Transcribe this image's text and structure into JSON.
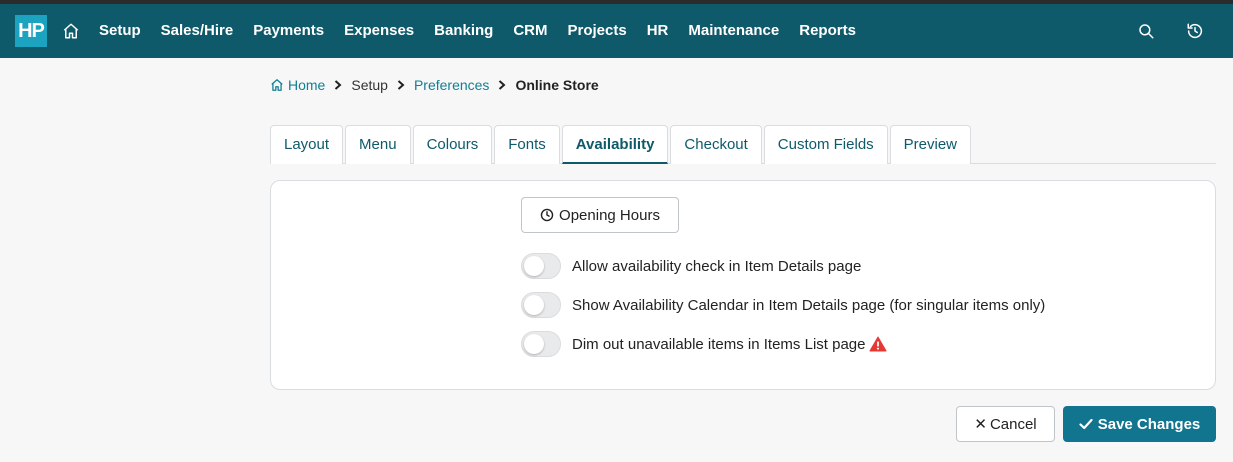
{
  "app": {
    "logo_text": "HP"
  },
  "nav": {
    "items": [
      "Setup",
      "Sales/Hire",
      "Payments",
      "Expenses",
      "Banking",
      "CRM",
      "Projects",
      "HR",
      "Maintenance",
      "Reports"
    ],
    "icons": [
      "home-icon",
      "search-icon",
      "history-icon"
    ]
  },
  "breadcrumb": {
    "home": "Home",
    "setup": "Setup",
    "preferences": "Preferences",
    "current": "Online Store"
  },
  "tabs": {
    "items": [
      "Layout",
      "Menu",
      "Colours",
      "Fonts",
      "Availability",
      "Checkout",
      "Custom Fields",
      "Preview"
    ],
    "active": "Availability"
  },
  "panel": {
    "opening_hours_label": "Opening Hours",
    "toggles": [
      {
        "label": "Allow availability check in Item Details page",
        "on": false
      },
      {
        "label": "Show Availability Calendar in Item Details page (for singular items only)",
        "on": false
      },
      {
        "label": "Dim out unavailable items in Items List page",
        "on": false,
        "warning": true
      }
    ]
  },
  "footer": {
    "cancel_label": "Cancel",
    "save_label": "Save Changes"
  },
  "colors": {
    "navbar": "#0e5a6b",
    "logo": "#1ba3bf",
    "link": "#127f94",
    "primary_button": "#127590",
    "warning": "#e53935"
  }
}
